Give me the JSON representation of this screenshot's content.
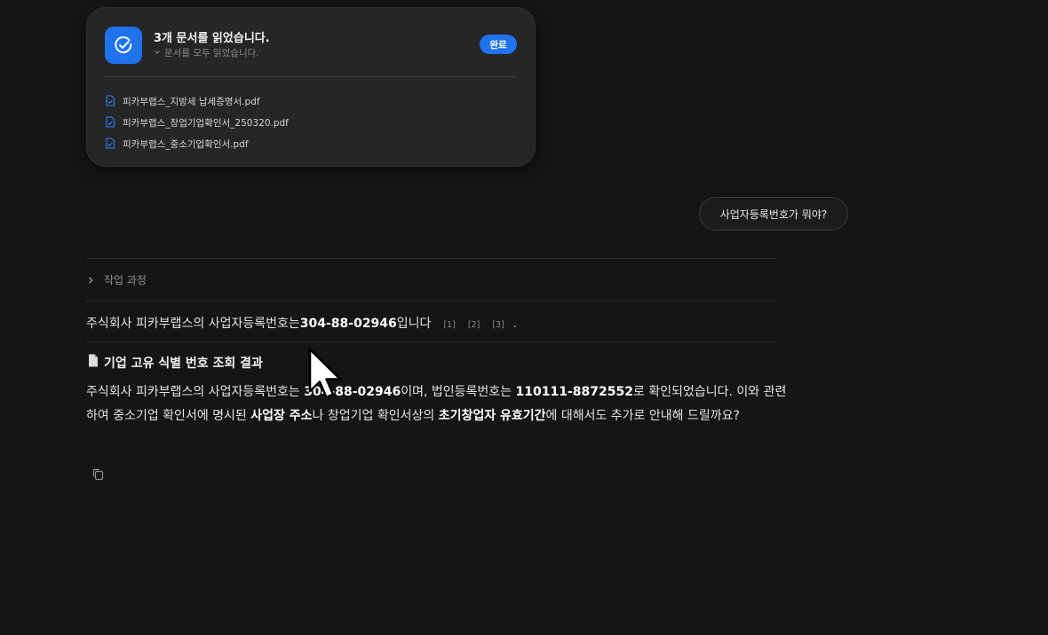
{
  "doc_card": {
    "title": "3개 문서를 읽었습니다.",
    "subtitle": "문서를 모두 읽었습니다.",
    "done_label": "완료",
    "files": [
      "피카부랩스_지방세 납세증명서.pdf",
      "피카부랩스_창업기업확인서_250320.pdf",
      "피카부랩스_중소기업확인서.pdf"
    ],
    "accent_color": "#1f73ee"
  },
  "user_message": "사업자등록번호가 뭐야?",
  "process": {
    "label": "작업 과정"
  },
  "answer": {
    "prefix": "주식회사 피카부랩스의 사업자등록번호는 ",
    "number": "304-88-02946",
    "suffix": "입니다",
    "citations": [
      "[1]",
      "[2]",
      "[3]"
    ],
    "end_mark": "."
  },
  "result": {
    "heading": "기업 고유 식별 번호 조회 결과",
    "p1": "주식회사 피카부랩스의 사업자등록번호는 ",
    "p1_bold": "304-88-02946",
    "p2": "이며, 법인등록번호는 ",
    "p2_bold": "110111-8872552",
    "p3": "로 확인되었습니다. 이와 관련하여 중소기업 확인서에 명시된 ",
    "p3_bold": "사업장 주소",
    "p4": "나 창업기업 확인서상의 ",
    "p4_bold": "초기창업자 유효기간",
    "p5": "에 대해서도 추가로 안내해 드릴까요?"
  },
  "icons": {
    "doc_card_icon": "check-circle-icon",
    "subtitle_icon": "chevron-down-icon",
    "file_icon": "document-check-icon",
    "process_icon": "chevron-right-icon",
    "heading_icon": "page-icon",
    "copy_icon": "copy-icon"
  }
}
